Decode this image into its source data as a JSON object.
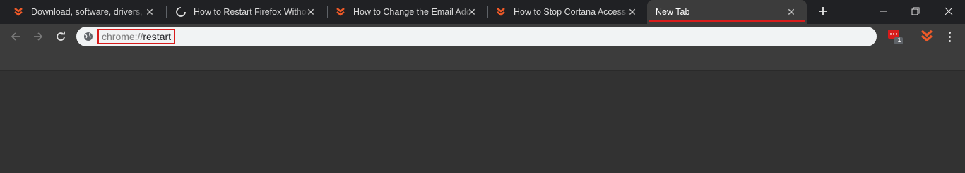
{
  "tabs": [
    {
      "title": "Download, software, drivers, games",
      "favicon": "brand-chevron-icon",
      "active": false
    },
    {
      "title": "How to Restart Firefox Without Losing Tabs",
      "favicon": "loading-spinner-icon",
      "active": false
    },
    {
      "title": "How to Change the Email Address",
      "favicon": "brand-chevron-icon",
      "active": false
    },
    {
      "title": "How to Stop Cortana Accessing",
      "favicon": "brand-chevron-icon",
      "active": false
    },
    {
      "title": "New Tab",
      "favicon": "",
      "active": true
    }
  ],
  "omnibox": {
    "scheme": "chrome://",
    "path": "restart"
  },
  "extensions": {
    "badge_count": "1"
  },
  "colors": {
    "highlight": "#d81b1b",
    "brand": "#f05a28",
    "titlebar": "#202124",
    "toolbar": "#3c3c3c",
    "page": "#323232"
  }
}
